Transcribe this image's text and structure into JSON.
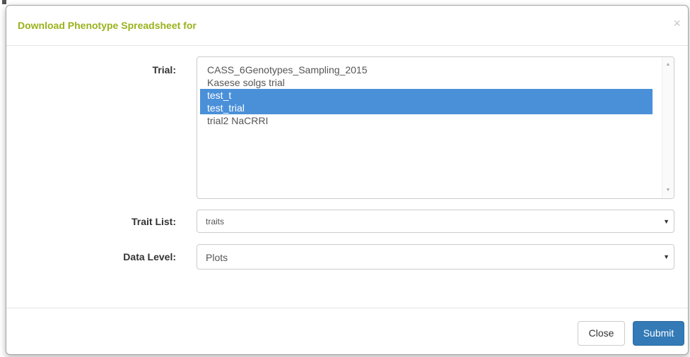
{
  "dialog": {
    "title": "Download Phenotype Spreadsheet for",
    "close_glyph": "×"
  },
  "form": {
    "trial": {
      "label": "Trial:",
      "options": [
        {
          "label": "CASS_6Genotypes_Sampling_2015",
          "selected": false
        },
        {
          "label": "Kasese solgs trial",
          "selected": false
        },
        {
          "label": "test_t",
          "selected": true
        },
        {
          "label": "test_trial",
          "selected": true
        },
        {
          "label": "trial2 NaCRRI",
          "selected": false
        }
      ],
      "scroll_up_glyph": "▲",
      "scroll_down_glyph": "▼"
    },
    "trait_list": {
      "label": "Trait List:",
      "value": "traits",
      "arrow_glyph": "▼"
    },
    "data_level": {
      "label": "Data Level:",
      "value": "Plots",
      "arrow_glyph": "▼"
    }
  },
  "footer": {
    "close_label": "Close",
    "submit_label": "Submit"
  },
  "colors": {
    "title": "#9ab21c",
    "selection": "#4a90d9",
    "primary_button": "#337ab7"
  }
}
